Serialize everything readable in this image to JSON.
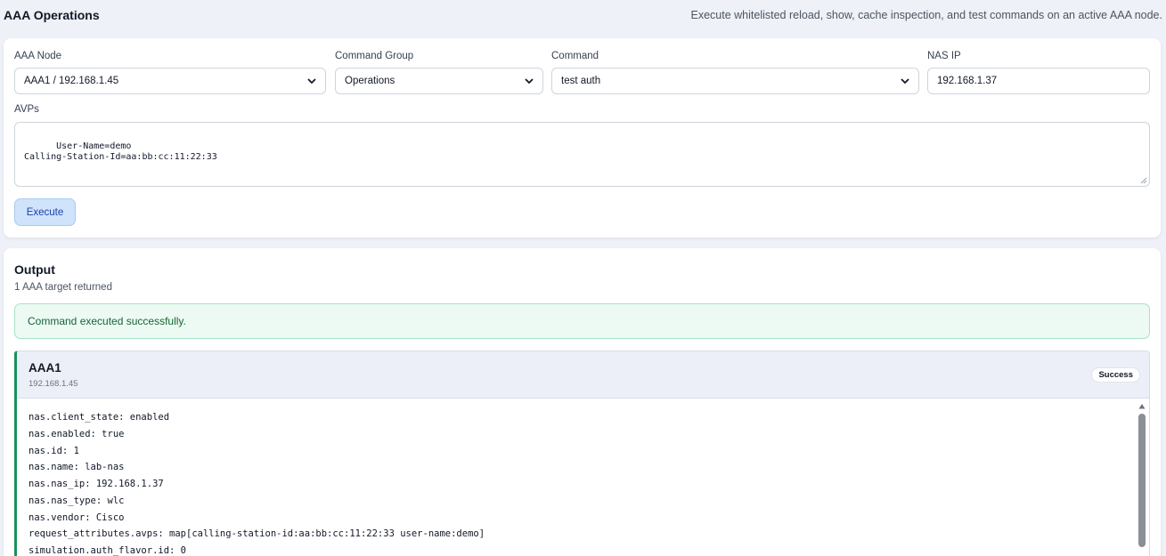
{
  "header": {
    "title": "AAA Operations",
    "subtitle": "Execute whitelisted reload, show, cache inspection, and test commands on an active AAA node."
  },
  "form": {
    "aaa_node_label": "AAA Node",
    "aaa_node_value": "AAA1 / 192.168.1.45",
    "command_group_label": "Command Group",
    "command_group_value": "Operations",
    "command_label": "Command",
    "command_value": "test auth",
    "nas_ip_label": "NAS IP",
    "nas_ip_value": "192.168.1.37",
    "avps_label": "AVPs",
    "avps_value": "User-Name=demo\nCalling-Station-Id=aa:bb:cc:11:22:33",
    "execute_label": "Execute"
  },
  "output": {
    "title": "Output",
    "subtitle": "1 AAA target returned",
    "alert": "Command executed successfully.",
    "target": {
      "name": "AAA1",
      "ip": "192.168.1.45",
      "status": "Success",
      "lines": [
        "nas.client_state: enabled",
        "nas.enabled: true",
        "nas.id: 1",
        "nas.name: lab-nas",
        "nas.nas_ip: 192.168.1.37",
        "nas.nas_type: wlc",
        "nas.vendor: Cisco",
        "request_attributes.avps: map[calling-station-id:aa:bb:cc:11:22:33 user-name:demo]",
        "simulation.auth_flavor.id: 0"
      ]
    }
  },
  "colors": {
    "accent": "#15935a",
    "button_bg": "#cfe3fb",
    "alert_bg": "#ecfaf3"
  },
  "icons": {
    "select_caret": "chevron-down-icon",
    "resize": "resize-grip-icon",
    "scroll_up": "scroll-up-icon"
  }
}
